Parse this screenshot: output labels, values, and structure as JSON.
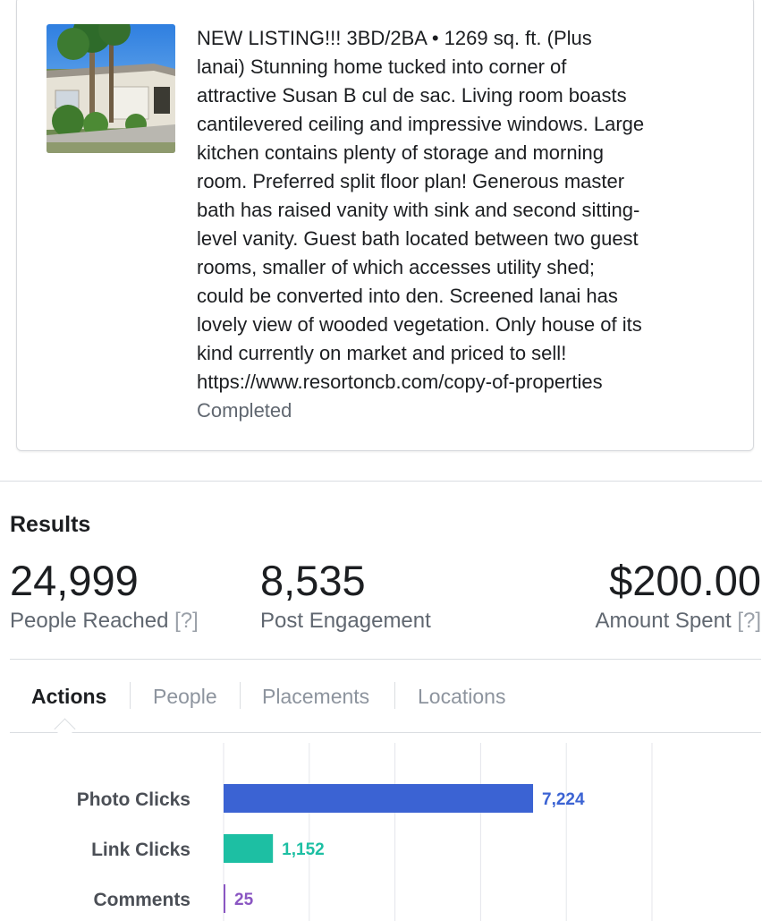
{
  "post": {
    "thumbnail_alt": "House with palm trees",
    "description_lines": [
      "NEW LISTING!!! 3BD/2BA • 1269 sq. ft. (Plus",
      "lanai) Stunning home tucked into corner of",
      "attractive Susan B cul de sac. Living room boasts",
      "cantilevered ceiling and impressive windows. Large",
      "kitchen contains plenty of storage and morning",
      "room. Preferred split floor plan! Generous master",
      "bath has raised vanity with sink and second sitting-",
      "level vanity. Guest bath located between two guest",
      "rooms, smaller of which accesses utility shed;",
      "could be converted into den. Screened lanai has",
      "lovely view of wooded vegetation. Only house of its",
      "kind currently on market and priced to sell!",
      "https://www.resortoncb.com/copy-of-properties"
    ],
    "status": "Completed"
  },
  "results": {
    "title": "Results",
    "people_reached": {
      "value": "24,999",
      "label": "People Reached",
      "help": "[?]"
    },
    "post_engagement": {
      "value": "8,535",
      "label": "Post Engagement"
    },
    "amount_spent": {
      "value": "$200.00",
      "label": "Amount Spent",
      "help": "[?]"
    }
  },
  "tabs": [
    {
      "label": "Actions",
      "active": true
    },
    {
      "label": "People",
      "active": false
    },
    {
      "label": "Placements",
      "active": false
    },
    {
      "label": "Locations",
      "active": false
    }
  ],
  "chart_data": {
    "type": "bar",
    "orientation": "horizontal",
    "categories": [
      "Photo Clicks",
      "Link Clicks",
      "Comments"
    ],
    "values": [
      7224,
      1152,
      25
    ],
    "value_labels": [
      "7,224",
      "1,152",
      "25"
    ],
    "colors": [
      "#3b63d3",
      "#1dbfa3",
      "#8a56c2"
    ],
    "xlim": [
      0,
      10000
    ],
    "grid": true
  }
}
